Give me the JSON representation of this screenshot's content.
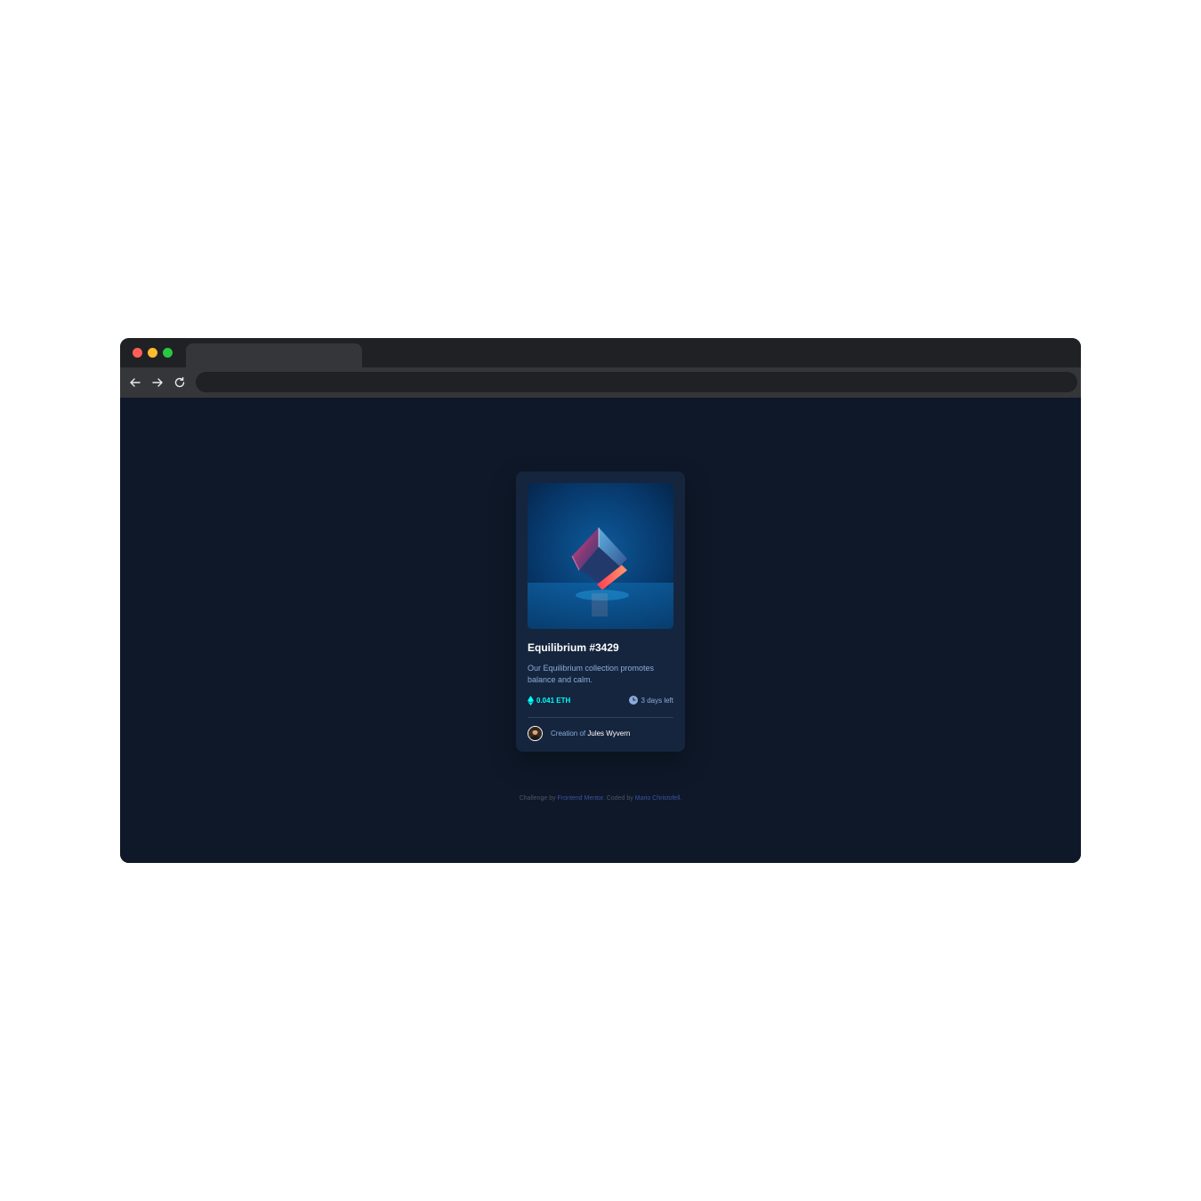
{
  "card": {
    "image_alt": "Equilibrium",
    "title": "Equilibrium #3429",
    "description": "Our Equilibrium collection promotes balance and calm.",
    "price": "0.041 ETH",
    "time_left": "3 days left",
    "creator_prefix": "Creation of",
    "creator_name": "Jules Wyvern"
  },
  "attribution": {
    "prefix": "Challenge by",
    "link1": "Frontend Mentor",
    "middle": ". Coded by",
    "link2": "Mario Christofell",
    "suffix": "."
  },
  "colors": {
    "page_bg": "#0e1828",
    "card_bg": "#15253e",
    "cyan": "#00fff8",
    "soft_blue": "#8bacd9",
    "link_blue": "#3e52a3",
    "chrome_dark": "#202124",
    "chrome_toolbar": "#35363a"
  },
  "icons": {
    "close": "red-dot-icon",
    "minimize": "yellow-dot-icon",
    "maximize": "green-dot-icon",
    "back": "arrow-left-icon",
    "forward": "arrow-right-icon",
    "reload": "reload-icon",
    "price": "ethereum-icon",
    "time": "clock-icon"
  }
}
